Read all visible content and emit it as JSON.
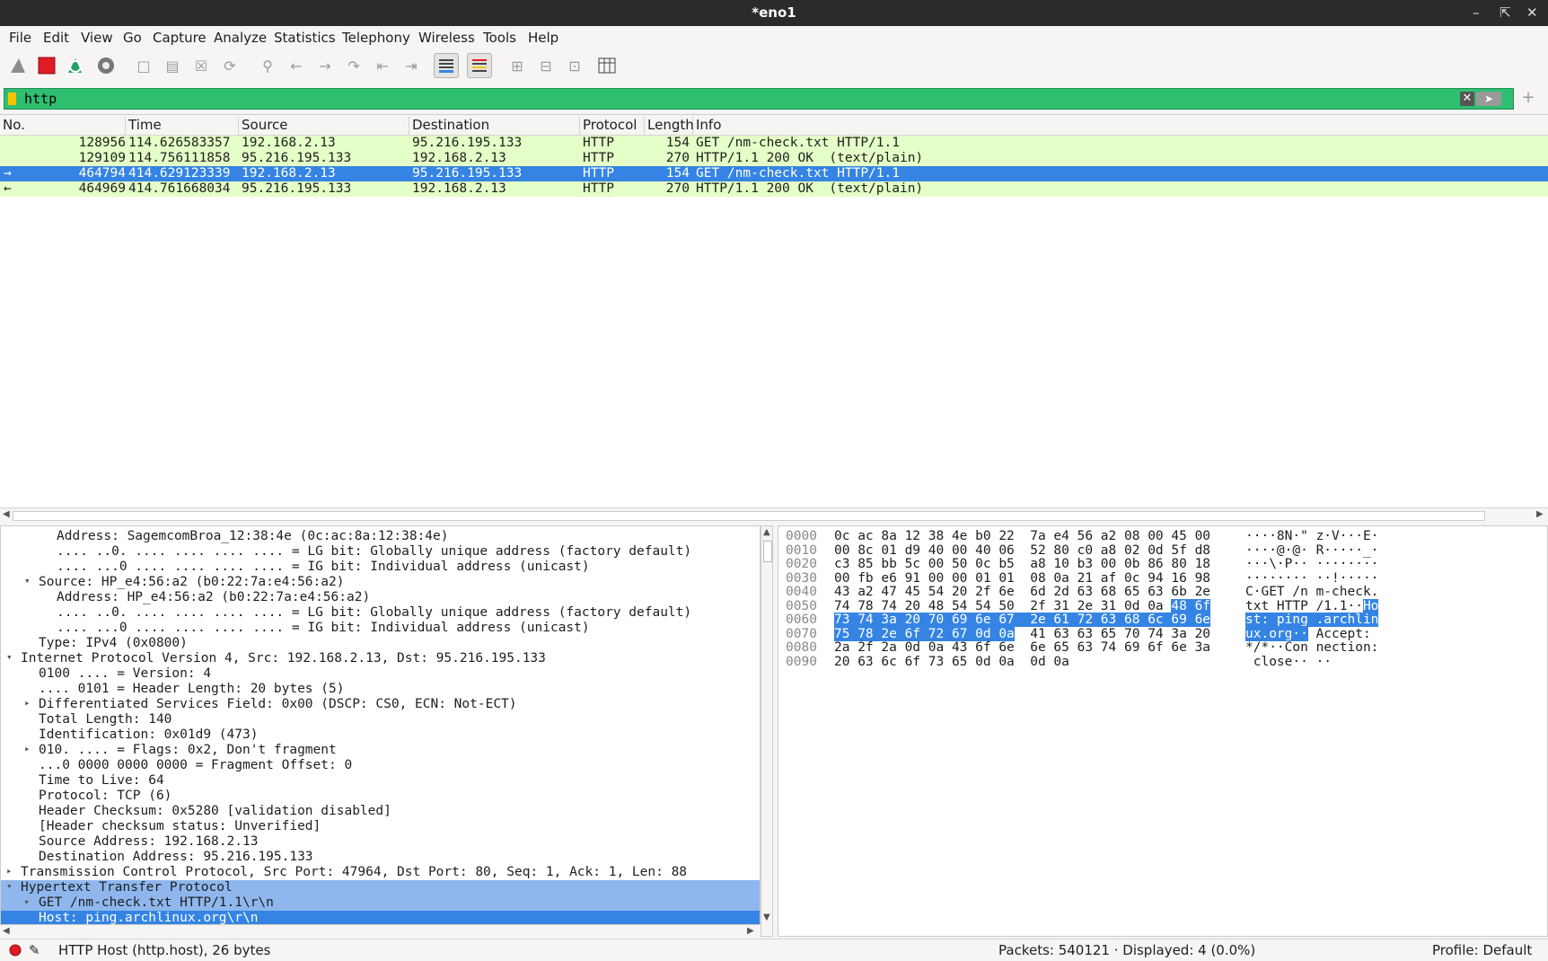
{
  "window": {
    "title": "*eno1"
  },
  "menu": [
    "File",
    "Edit",
    "View",
    "Go",
    "Capture",
    "Analyze",
    "Statistics",
    "Telephony",
    "Wireless",
    "Tools",
    "Help"
  ],
  "toolbar": {
    "icons": [
      "shark-fin-start-icon",
      "stop-capture-icon",
      "restart-capture-icon",
      "capture-options-icon",
      "open-file-icon",
      "save-file-icon",
      "close-file-icon",
      "reload-file-icon",
      "find-packet-icon",
      "go-back-icon",
      "go-forward-icon",
      "go-to-packet-icon",
      "first-packet-icon",
      "last-packet-icon",
      "autoscroll-icon",
      "colorize-icon",
      "zoom-in-icon",
      "zoom-out-icon",
      "normal-size-icon",
      "resize-columns-icon"
    ],
    "colors": {
      "stop": "#e01b24",
      "restart": "#26a269"
    }
  },
  "filter": {
    "value": "http",
    "valid_color": "#2fbf71"
  },
  "packet_list": {
    "columns": [
      "No.",
      "Time",
      "Source",
      "Destination",
      "Protocol",
      "Length",
      "Info"
    ],
    "rows": [
      {
        "no": "128956",
        "time": "114.626583357",
        "source": "192.168.2.13",
        "destination": "95.216.195.133",
        "protocol": "HTTP",
        "length": "154",
        "info": "GET /nm-check.txt HTTP/1.1",
        "selected": false,
        "marker": ""
      },
      {
        "no": "129109",
        "time": "114.756111858",
        "source": "95.216.195.133",
        "destination": "192.168.2.13",
        "protocol": "HTTP",
        "length": "270",
        "info": "HTTP/1.1 200 OK  (text/plain)",
        "selected": false,
        "marker": ""
      },
      {
        "no": "464794",
        "time": "414.629123339",
        "source": "192.168.2.13",
        "destination": "95.216.195.133",
        "protocol": "HTTP",
        "length": "154",
        "info": "GET /nm-check.txt HTTP/1.1",
        "selected": true,
        "marker": "→"
      },
      {
        "no": "464969",
        "time": "414.761668034",
        "source": "95.216.195.133",
        "destination": "192.168.2.13",
        "protocol": "HTTP",
        "length": "270",
        "info": "HTTP/1.1 200 OK  (text/plain)",
        "selected": false,
        "marker": "←"
      }
    ],
    "row_color": "#e4ffc7",
    "selected_color": "#3584e4"
  },
  "details": [
    {
      "indent": 3,
      "tri": "",
      "text": "Address: SagemcomBroa_12:38:4e (0c:ac:8a:12:38:4e)",
      "state": ""
    },
    {
      "indent": 3,
      "tri": "",
      "text": ".... ..0. .... .... .... .... = LG bit: Globally unique address (factory default)",
      "state": ""
    },
    {
      "indent": 3,
      "tri": "",
      "text": ".... ...0 .... .... .... .... = IG bit: Individual address (unicast)",
      "state": ""
    },
    {
      "indent": 2,
      "tri": "▾",
      "text": "Source: HP_e4:56:a2 (b0:22:7a:e4:56:a2)",
      "state": ""
    },
    {
      "indent": 3,
      "tri": "",
      "text": "Address: HP_e4:56:a2 (b0:22:7a:e4:56:a2)",
      "state": ""
    },
    {
      "indent": 3,
      "tri": "",
      "text": ".... ..0. .... .... .... .... = LG bit: Globally unique address (factory default)",
      "state": ""
    },
    {
      "indent": 3,
      "tri": "",
      "text": ".... ...0 .... .... .... .... = IG bit: Individual address (unicast)",
      "state": ""
    },
    {
      "indent": 2,
      "tri": "",
      "text": "Type: IPv4 (0x0800)",
      "state": ""
    },
    {
      "indent": 1,
      "tri": "▾",
      "text": "Internet Protocol Version 4, Src: 192.168.2.13, Dst: 95.216.195.133",
      "state": ""
    },
    {
      "indent": 2,
      "tri": "",
      "text": "0100 .... = Version: 4",
      "state": ""
    },
    {
      "indent": 2,
      "tri": "",
      "text": ".... 0101 = Header Length: 20 bytes (5)",
      "state": ""
    },
    {
      "indent": 2,
      "tri": "▸",
      "text": "Differentiated Services Field: 0x00 (DSCP: CS0, ECN: Not-ECT)",
      "state": ""
    },
    {
      "indent": 2,
      "tri": "",
      "text": "Total Length: 140",
      "state": ""
    },
    {
      "indent": 2,
      "tri": "",
      "text": "Identification: 0x01d9 (473)",
      "state": ""
    },
    {
      "indent": 2,
      "tri": "▸",
      "text": "010. .... = Flags: 0x2, Don't fragment",
      "state": ""
    },
    {
      "indent": 2,
      "tri": "",
      "text": "...0 0000 0000 0000 = Fragment Offset: 0",
      "state": ""
    },
    {
      "indent": 2,
      "tri": "",
      "text": "Time to Live: 64",
      "state": ""
    },
    {
      "indent": 2,
      "tri": "",
      "text": "Protocol: TCP (6)",
      "state": ""
    },
    {
      "indent": 2,
      "tri": "",
      "text": "Header Checksum: 0x5280 [validation disabled]",
      "state": ""
    },
    {
      "indent": 2,
      "tri": "",
      "text": "[Header checksum status: Unverified]",
      "state": ""
    },
    {
      "indent": 2,
      "tri": "",
      "text": "Source Address: 192.168.2.13",
      "state": ""
    },
    {
      "indent": 2,
      "tri": "",
      "text": "Destination Address: 95.216.195.133",
      "state": ""
    },
    {
      "indent": 1,
      "tri": "▸",
      "text": "Transmission Control Protocol, Src Port: 47964, Dst Port: 80, Seq: 1, Ack: 1, Len: 88",
      "state": ""
    },
    {
      "indent": 1,
      "tri": "▾",
      "text": "Hypertext Transfer Protocol",
      "state": "hl"
    },
    {
      "indent": 2,
      "tri": "▸",
      "text": "GET /nm-check.txt HTTP/1.1\\r\\n",
      "state": "hl"
    },
    {
      "indent": 2,
      "tri": "",
      "text": "Host: ping.archlinux.org\\r\\n",
      "state": "sel"
    }
  ],
  "bytes": [
    {
      "offset": "0000",
      "hex": [
        [
          "0c ac 8a 12 38 4e b0 22  7a e4 56 a2 08 00 45 00",
          ""
        ]
      ],
      "ascii": [
        [
          "····8N·\" z·V···E·",
          ""
        ]
      ]
    },
    {
      "offset": "0010",
      "hex": [
        [
          "00 8c 01 d9 40 00 40 06  52 80 c0 a8 02 0d 5f d8",
          ""
        ]
      ],
      "ascii": [
        [
          "····@·@· R·····_·",
          ""
        ]
      ]
    },
    {
      "offset": "0020",
      "hex": [
        [
          "c3 85 bb 5c 00 50 0c b5  a8 10 b3 00 0b 86 80 18",
          ""
        ]
      ],
      "ascii": [
        [
          "···\\·P·· ········",
          ""
        ]
      ]
    },
    {
      "offset": "0030",
      "hex": [
        [
          "00 fb e6 91 00 00 01 01  08 0a 21 af 0c 94 16 98",
          ""
        ]
      ],
      "ascii": [
        [
          "········ ··!·····",
          ""
        ]
      ]
    },
    {
      "offset": "0040",
      "hex": [
        [
          "43 a2 47 45 54 20 2f 6e  6d 2d 63 68 65 63 6b 2e",
          ""
        ]
      ],
      "ascii": [
        [
          "C·GET /n m-check.",
          ""
        ]
      ]
    },
    {
      "offset": "0050",
      "hex": [
        [
          "74 78 74 20 48 54 54 50  2f 31 2e 31 0d 0a ",
          ""
        ],
        [
          "48 6f",
          "h"
        ]
      ],
      "ascii": [
        [
          "txt HTTP /1.1··",
          ""
        ],
        [
          "Ho",
          "h"
        ]
      ]
    },
    {
      "offset": "0060",
      "hex": [
        [
          "73 74 3a 20 70 69 6e 67  2e 61 72 63 68 6c 69 6e",
          "h"
        ]
      ],
      "ascii": [
        [
          "st: ping .archlin",
          "h"
        ]
      ]
    },
    {
      "offset": "0070",
      "hex": [
        [
          "75 78 2e 6f 72 67 0d 0a",
          "h"
        ],
        [
          "  41 63 63 65 70 74 3a 20",
          ""
        ]
      ],
      "ascii": [
        [
          "ux.org··",
          "h"
        ],
        [
          " Accept: ",
          ""
        ]
      ]
    },
    {
      "offset": "0080",
      "hex": [
        [
          "2a 2f 2a 0d 0a 43 6f 6e  6e 65 63 74 69 6f 6e 3a",
          ""
        ]
      ],
      "ascii": [
        [
          "*/*··Con nection:",
          ""
        ]
      ]
    },
    {
      "offset": "0090",
      "hex": [
        [
          "20 63 6c 6f 73 65 0d 0a  0d 0a",
          ""
        ]
      ],
      "ascii": [
        [
          " close·· ··",
          ""
        ]
      ]
    }
  ],
  "status": {
    "field": "HTTP Host (http.host), 26 bytes",
    "packets": "Packets: 540121 · Displayed: 4 (0.0%)",
    "profile": "Profile: Default"
  }
}
